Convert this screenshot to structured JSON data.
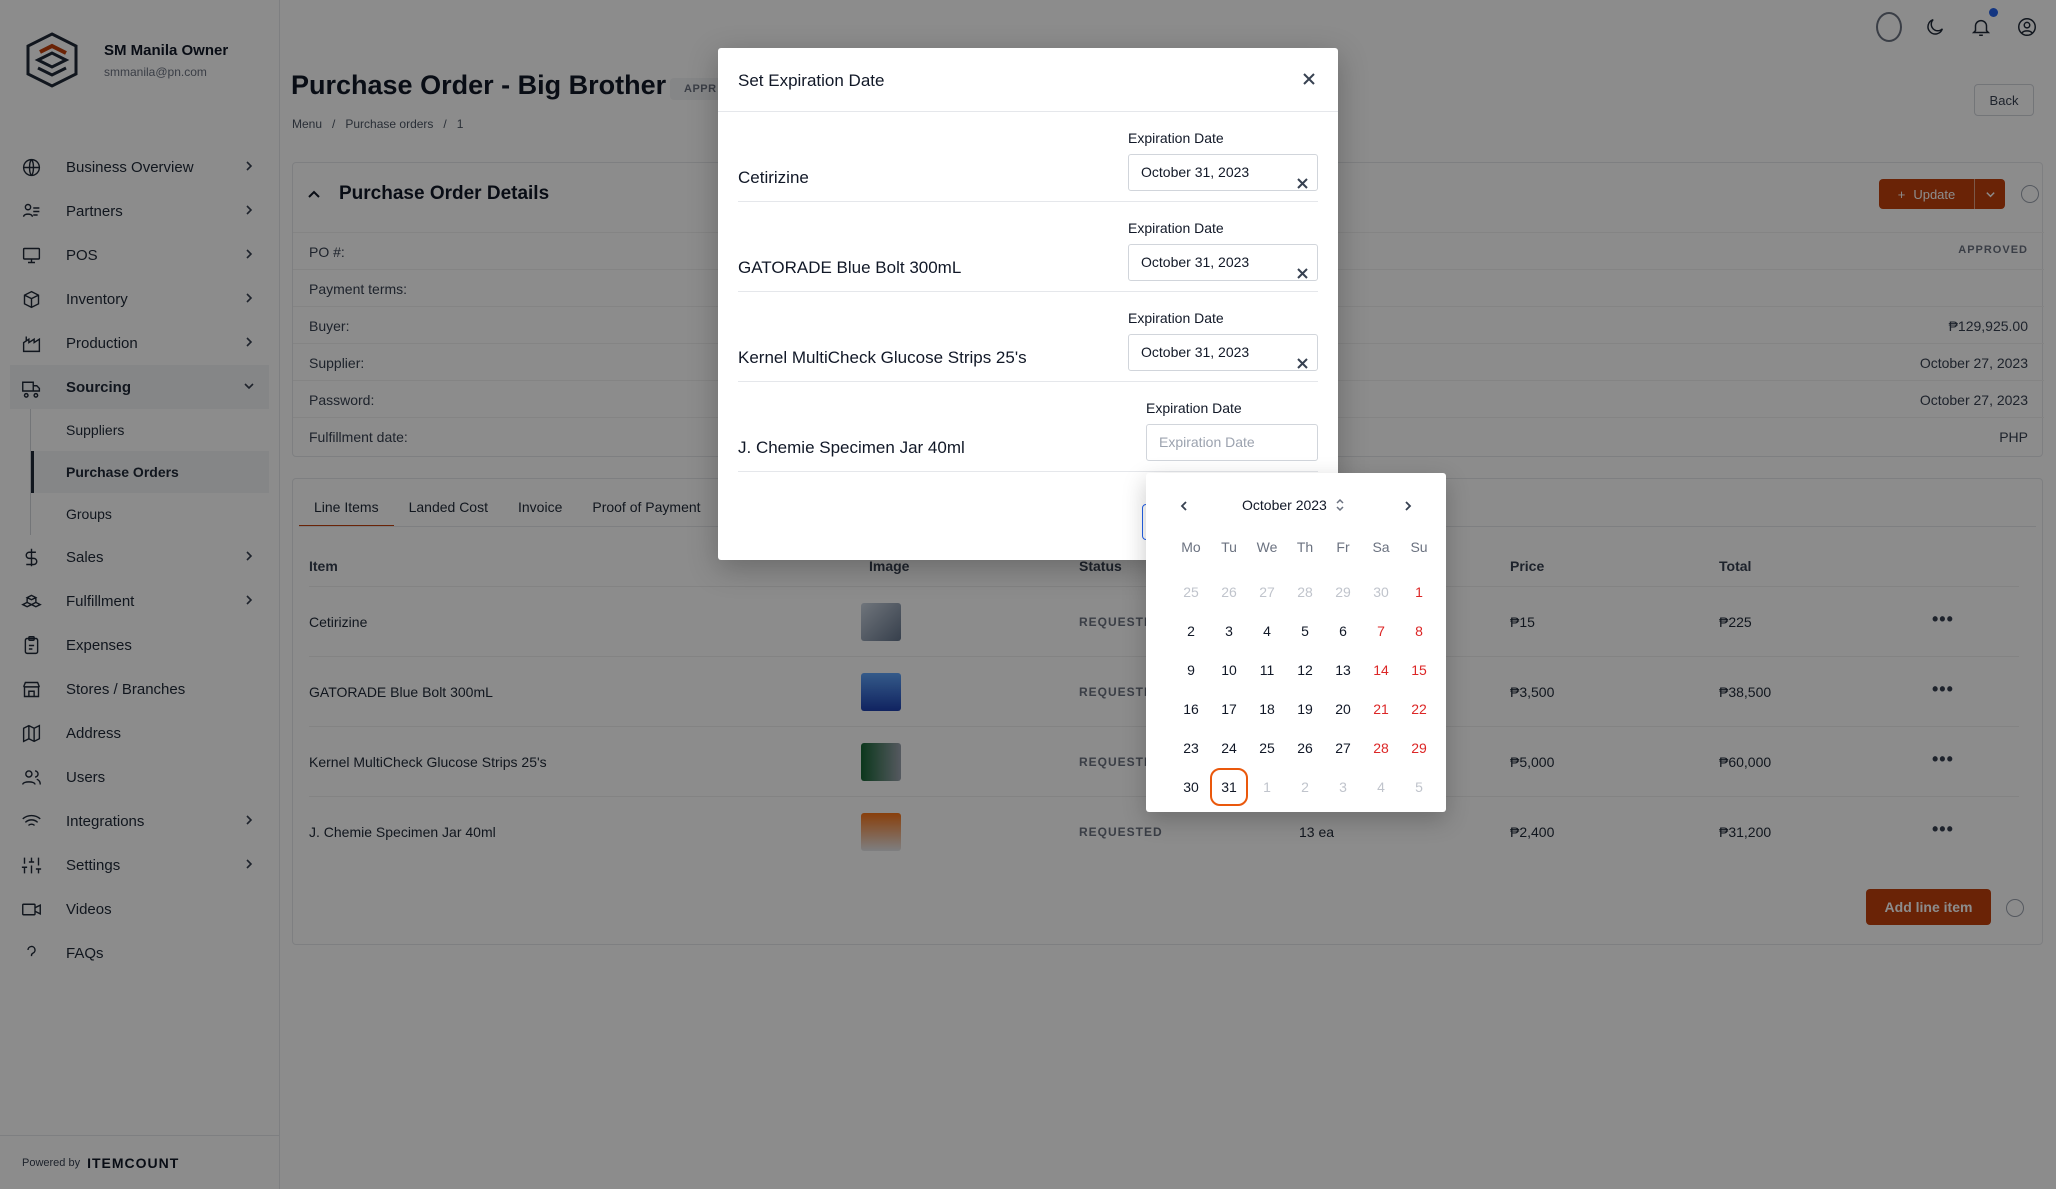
{
  "brand": {
    "name": "SM Manila Owner",
    "email": "smmanila@pn.com"
  },
  "nav": {
    "items": [
      {
        "label": "Business Overview",
        "icon": "globe-icon",
        "chevron": true
      },
      {
        "label": "Partners",
        "icon": "partners-icon",
        "chevron": true
      },
      {
        "label": "POS",
        "icon": "monitor-icon",
        "chevron": true
      },
      {
        "label": "Inventory",
        "icon": "box-icon",
        "chevron": true
      },
      {
        "label": "Production",
        "icon": "factory-icon",
        "chevron": true
      },
      {
        "label": "Sourcing",
        "icon": "truck-icon",
        "chevron": true
      }
    ],
    "sourcing_sub": [
      {
        "label": "Suppliers"
      },
      {
        "label": "Purchase Orders"
      },
      {
        "label": "Groups"
      }
    ],
    "items_after": [
      {
        "label": "Sales",
        "icon": "dollar-icon",
        "chevron": true
      },
      {
        "label": "Fulfillment",
        "icon": "boxes-icon",
        "chevron": true
      },
      {
        "label": "Expenses",
        "icon": "clipboard-icon",
        "chevron": false
      },
      {
        "label": "Stores / Branches",
        "icon": "store-icon",
        "chevron": false
      },
      {
        "label": "Address",
        "icon": "map-icon",
        "chevron": false
      },
      {
        "label": "Users",
        "icon": "users-icon",
        "chevron": false
      },
      {
        "label": "Integrations",
        "icon": "wifi-icon",
        "chevron": true
      },
      {
        "label": "Settings",
        "icon": "sliders-icon",
        "chevron": true
      },
      {
        "label": "Videos",
        "icon": "video-icon",
        "chevron": false
      },
      {
        "label": "FAQs",
        "icon": "question-icon",
        "chevron": false
      }
    ]
  },
  "footer": {
    "powered_by": "Powered by",
    "logo": "ITEMCOUNT"
  },
  "page": {
    "title": "Purchase Order - Big Brother",
    "status": "APPR",
    "breadcrumb": [
      "Menu",
      "/",
      "Purchase orders",
      "/",
      "1"
    ],
    "back_label": "Back"
  },
  "details": {
    "title": "Purchase Order Details",
    "update_label": "Update",
    "rows": [
      {
        "key": "PO #:",
        "value": "APPROVED"
      },
      {
        "key": "Payment terms:",
        "value": ""
      },
      {
        "key": "Buyer:",
        "value": "₱129,925.00"
      },
      {
        "key": "Supplier:",
        "value": "October 27, 2023"
      },
      {
        "key": "Password:",
        "value": "October 27, 2023"
      },
      {
        "key": "Fulfillment date:",
        "value": "PHP"
      }
    ]
  },
  "line_items": {
    "tabs": [
      "Line Items",
      "Landed Cost",
      "Invoice",
      "Proof of Payment"
    ],
    "columns": {
      "item": "Item",
      "image": "Image",
      "status": "Status",
      "price": "Price",
      "total": "Total"
    },
    "rows": [
      {
        "item": "Cetirizine",
        "status": "REQUESTED",
        "qty": "",
        "price": "₱15",
        "total": "₱225"
      },
      {
        "item": "GATORADE Blue Bolt 300mL",
        "status": "REQUESTED",
        "qty": "",
        "price": "₱3,500",
        "total": "₱38,500"
      },
      {
        "item": "Kernel MultiCheck Glucose Strips 25's",
        "status": "REQUESTED",
        "qty": "",
        "price": "₱5,000",
        "total": "₱60,000"
      },
      {
        "item": "J. Chemie Specimen Jar 40ml",
        "status": "REQUESTED",
        "qty": "13 ea",
        "price": "₱2,400",
        "total": "₱31,200"
      }
    ],
    "more_label": "•••",
    "add_label": "Add line item"
  },
  "modal": {
    "title": "Set Expiration Date",
    "field_label": "Expiration Date",
    "placeholder": "Expiration Date",
    "rows": [
      {
        "name": "Cetirizine",
        "value": "October 31, 2023"
      },
      {
        "name": "GATORADE Blue Bolt 300mL",
        "value": "October 31, 2023"
      },
      {
        "name": "Kernel MultiCheck Glucose Strips 25's",
        "value": "October 31, 2023"
      },
      {
        "name": "J. Chemie Specimen Jar 40ml",
        "value": ""
      }
    ]
  },
  "picker": {
    "month_label": "October 2023",
    "weekdays": [
      "Mo",
      "Tu",
      "We",
      "Th",
      "Fr",
      "Sa",
      "Su"
    ],
    "weeks": [
      [
        "25",
        "26",
        "27",
        "28",
        "29",
        "30",
        "1"
      ],
      [
        "2",
        "3",
        "4",
        "5",
        "6",
        "7",
        "8"
      ],
      [
        "9",
        "10",
        "11",
        "12",
        "13",
        "14",
        "15"
      ],
      [
        "16",
        "17",
        "18",
        "19",
        "20",
        "21",
        "22"
      ],
      [
        "23",
        "24",
        "25",
        "26",
        "27",
        "28",
        "29"
      ],
      [
        "30",
        "31",
        "1",
        "2",
        "3",
        "4",
        "5"
      ]
    ],
    "selected": "31",
    "colors": {
      "weekend": "#dc2626",
      "selected_ring": "#ea580c"
    }
  },
  "colors": {
    "accent": "#c2410c",
    "overlay": "rgba(0,0,0,0.45)"
  }
}
